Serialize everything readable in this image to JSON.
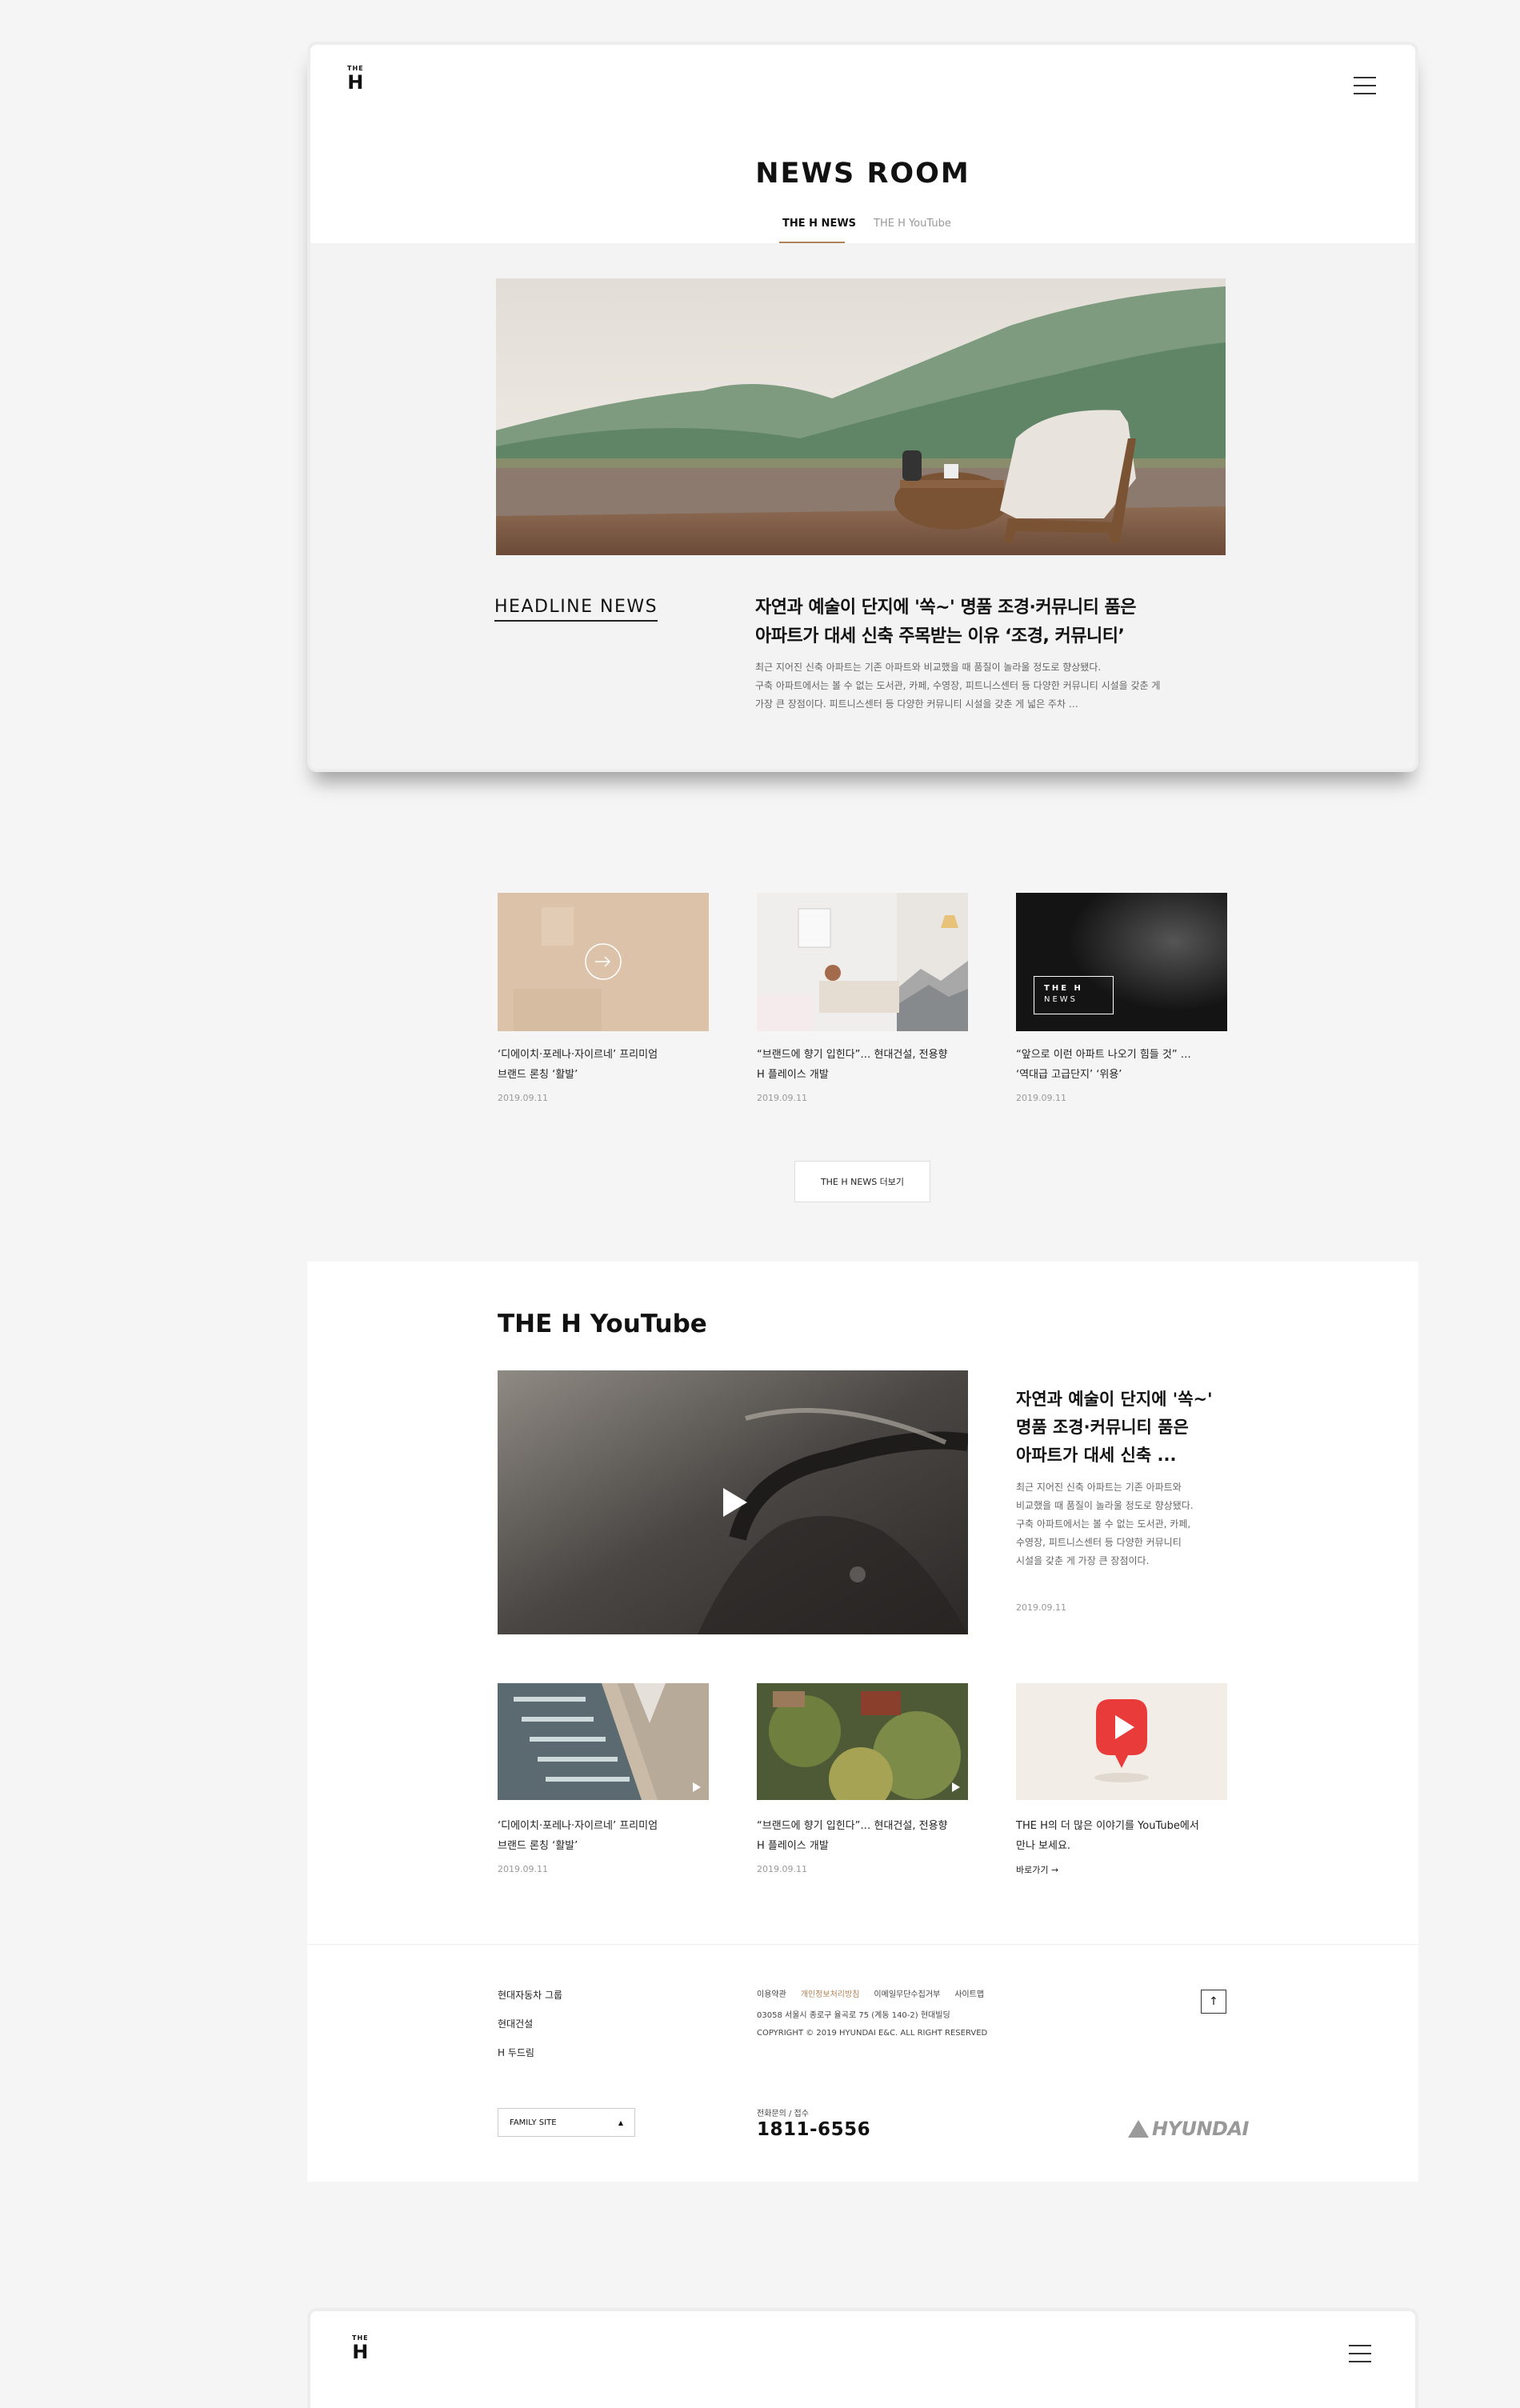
{
  "logo": {
    "small": "THE",
    "large": "H"
  },
  "newsroom": {
    "title": "NEWS ROOM",
    "tabs": [
      {
        "label": "THE H NEWS"
      },
      {
        "label": "THE H YouTube"
      }
    ],
    "headline": {
      "label": "HEADLINE NEWS",
      "title_line1": "자연과 예술이 단지에 '쏙~' 명품 조경·커뮤니티 품은",
      "title_line2": "아파트가 대세 신축 주목받는 이유 ‘조경, 커뮤니티’",
      "excerpt_line1": "최근 지어진 신축 아파트는 기존 아파트와 비교했을 때 품질이 놀라울 정도로 향상됐다.",
      "excerpt_line2": "구축 아파트에서는 볼 수 없는 도서관, 카페, 수영장, 피트니스센터 등 다양한 커뮤니티 시설을 갖춘 게",
      "excerpt_line3": "가장 큰 장점이다. 피트니스센터 등 다양한 커뮤니티 시설을 갖춘 게 넓은 주차 …"
    },
    "cards": [
      {
        "title_line1": "‘디에이치·포레나·자이르네’ 프리미엄",
        "title_line2": "브랜드 론칭 ‘활발’",
        "date": "2019.09.11"
      },
      {
        "title_line1": "“브랜드에 향기 입힌다”… 현대건설, 전용향",
        "title_line2": " H 플레이스 개발",
        "date": "2019.09.11"
      },
      {
        "title_line1": "“앞으로 이런 아파트 나오기 힘들 것” …",
        "title_line2": "‘역대급 고급단지’ ‘위용’",
        "date": "2019.09.11"
      }
    ],
    "card3_badge_line1": "THE H",
    "card3_badge_line2": "NEWS",
    "more_button": "THE H NEWS 더보기"
  },
  "youtube": {
    "heading": "THE H YouTube",
    "featured": {
      "title_line1": "자연과 예술이 단지에 '쏙~'",
      "title_line2": "명품 조경·커뮤니티 품은",
      "title_line3": "아파트가 대세 신축 ...",
      "excerpt_line1": "최근 지어진 신축 아파트는 기존 아파트와",
      "excerpt_line2": "비교했을 때 품질이 놀라울 정도로 향상됐다.",
      "excerpt_line3": "구축 아파트에서는 볼 수 없는 도서관, 카페,",
      "excerpt_line4": "수영장, 피트니스센터 등 다양한 커뮤니티",
      "excerpt_line5": "시설을 갖춘 게 가장 큰 장점이다.",
      "date": "2019.09.11"
    },
    "cards": [
      {
        "title_line1": "‘디에이치·포레나·자이르네’ 프리미엄",
        "title_line2": "브랜드 론칭 ‘활발’",
        "date": "2019.09.11"
      },
      {
        "title_line1": "“브랜드에 향기 입힌다”… 현대건설, 전용향",
        "title_line2": " H 플레이스 개발",
        "date": "2019.09.11"
      }
    ],
    "promo": {
      "line1": "THE H의 더 많은 이야기를 YouTube에서",
      "line2": "만나 보세요.",
      "link": "바로가기 →"
    }
  },
  "footer": {
    "links_left": [
      "현대자동차 그룹",
      "현대건설",
      "H 두드림"
    ],
    "links_top": [
      "이용약관",
      "개인정보처리방침",
      "이메일무단수집거부",
      "사이트맵"
    ],
    "address": "03058 서울시 종로구 율곡로 75 (계동 140-2) 현대빌딩",
    "copyright": "COPYRIGHT © 2019 HYUNDAI E&C. ALL RIGHT RESERVED",
    "family_site": "FAMILY SITE",
    "phone_label": "전화문의 / 접수",
    "phone": "1811-6556",
    "up": "↑",
    "brand": "HYUNDAI"
  },
  "colors": {
    "accent": "#b08257",
    "privacy": "#b08257"
  }
}
